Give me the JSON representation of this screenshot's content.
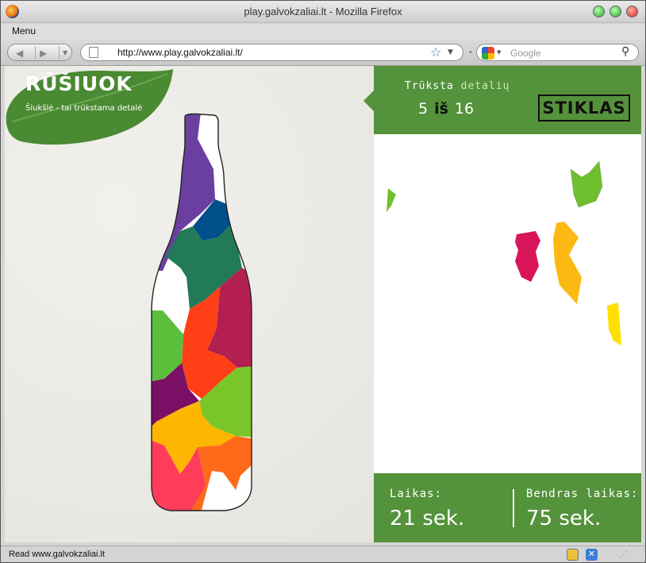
{
  "window": {
    "title": "play.galvokzaliai.lt - Mozilla Firefox"
  },
  "menubar": {
    "menu_label": "Menu"
  },
  "navbar": {
    "url": "http://www.play.galvokzaliai.lt/",
    "search_placeholder": "Google"
  },
  "game": {
    "logo_title": "RŪŠIUOK",
    "logo_subtitle": "Šiukšlė - tai trūkstama detalė",
    "missing_label_1": "Trūksta",
    "missing_label_2": "detalių",
    "missing_count": "5",
    "missing_of": "iš",
    "total_count": "16",
    "category": "STIKLAS",
    "time_label": "Laikas:",
    "time_value": "21 sek.",
    "total_time_label": "Bendras laikas:",
    "total_time_value": "75 sek.",
    "remaining_piece_colors": [
      "#6fbf2e",
      "#d9145a",
      "#fdb913",
      "#ffe000",
      "#6fbf2e"
    ]
  },
  "statusbar": {
    "text": "Read www.galvokzaliai.lt"
  },
  "colors": {
    "accent_green": "#54923b",
    "page_bg": "#ecebe6"
  }
}
